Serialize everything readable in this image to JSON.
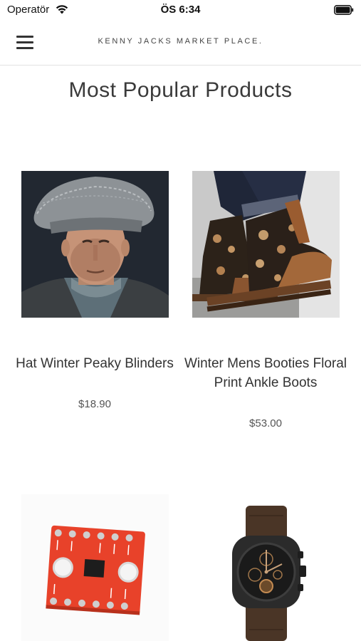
{
  "status_bar": {
    "carrier": "Operatör",
    "time": "ÖS 6:34",
    "wifi_icon": "wifi-icon",
    "battery_icon": "battery-icon"
  },
  "nav": {
    "menu_icon": "hamburger-menu-icon",
    "store_title": "KENNY JACKS MARKET PLACE."
  },
  "page": {
    "title": "Most Popular Products"
  },
  "products": [
    {
      "name": "Hat Winter Peaky Blinders",
      "price": "$18.90",
      "image": "flat-cap-man-photo"
    },
    {
      "name": "Winter Mens Booties Floral Print Ankle Boots",
      "price": "$53.00",
      "image": "floral-boots-photo"
    },
    {
      "name": "",
      "price": "",
      "image": "sensor-breakout-board-photo"
    },
    {
      "name": "",
      "price": "",
      "image": "fossil-watch-photo"
    }
  ],
  "colors": {
    "background": "#ffffff",
    "text": "#333333",
    "divider": "#e2e2e2",
    "pcb_red": "#e8422a"
  }
}
